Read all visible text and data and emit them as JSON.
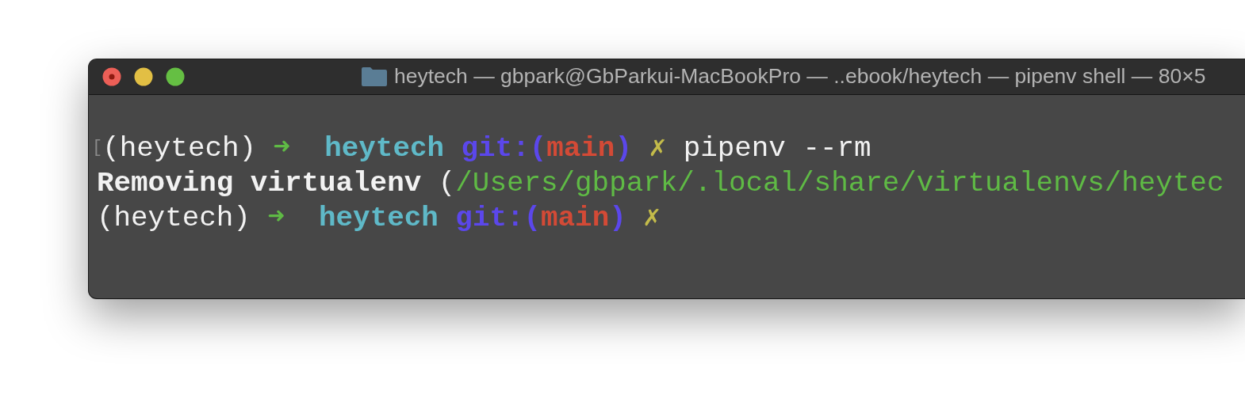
{
  "window": {
    "title": "heytech — gbpark@GbParkui-MacBookPro — ..ebook/heytech — pipenv shell — 80×5"
  },
  "terminal": {
    "lines": [
      {
        "segments": [
          {
            "kind": "marker",
            "text": "["
          },
          {
            "kind": "plain",
            "text": "(heytech)"
          },
          {
            "kind": "arrow",
            "text": "➜"
          },
          {
            "kind": "dir",
            "text": "heytech"
          },
          {
            "kind": "git",
            "text": "git:("
          },
          {
            "kind": "branch",
            "text": "main"
          },
          {
            "kind": "git_end",
            "text": ")"
          },
          {
            "kind": "dirty",
            "text": "✗"
          },
          {
            "kind": "command",
            "text": "pipenv --rm"
          }
        ]
      },
      {
        "segments": [
          {
            "kind": "bold",
            "text": "Removing virtualenv"
          },
          {
            "kind": "plain",
            "text": "("
          },
          {
            "kind": "path",
            "text": "/Users/gbpark/.local/share/virtualenvs/heytec"
          }
        ]
      },
      {
        "segments": [
          {
            "kind": "plain",
            "text": "(heytech)"
          },
          {
            "kind": "arrow",
            "text": "➜"
          },
          {
            "kind": "dir",
            "text": "heytech"
          },
          {
            "kind": "git",
            "text": "git:("
          },
          {
            "kind": "branch",
            "text": "main"
          },
          {
            "kind": "git_end",
            "text": ")"
          },
          {
            "kind": "dirty",
            "text": "✗"
          }
        ]
      }
    ]
  }
}
